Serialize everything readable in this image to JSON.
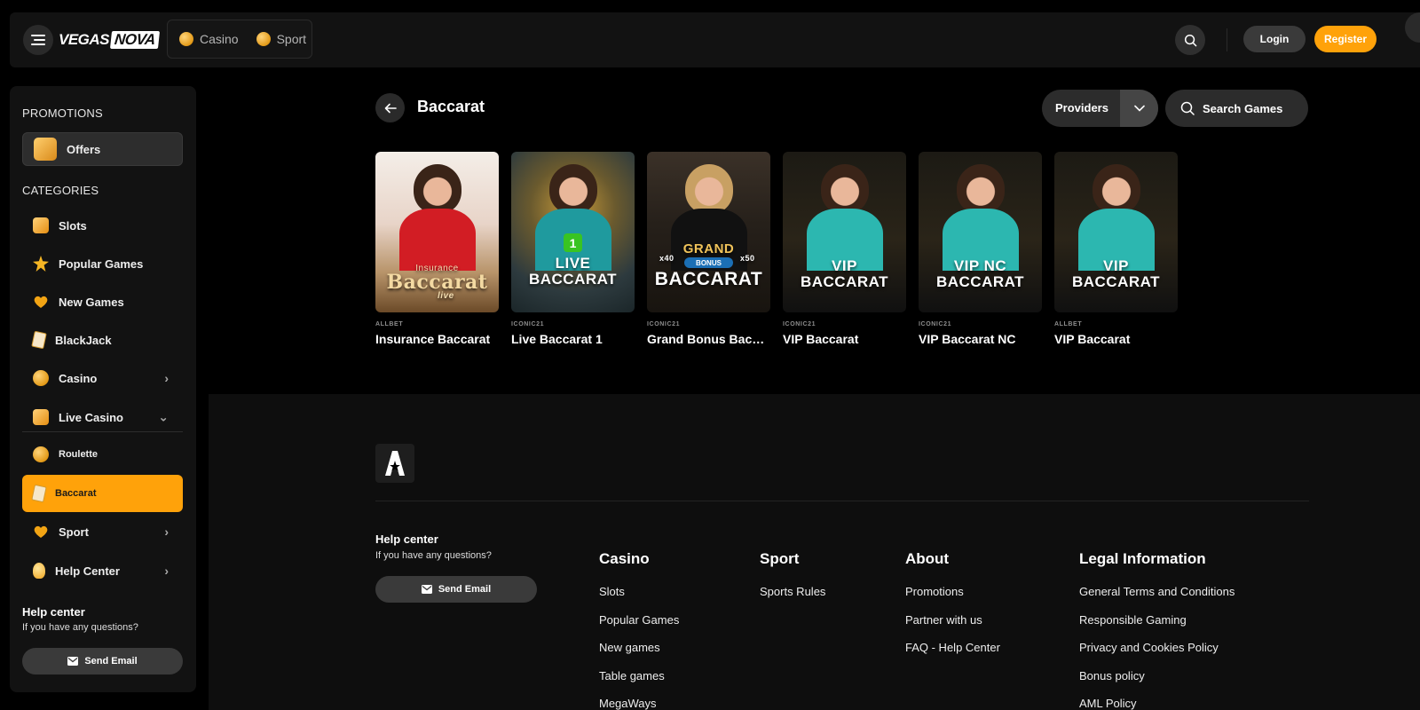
{
  "brand": {
    "logo_main": "VEGAS",
    "logo_accent": "NOVA"
  },
  "topnav": [
    {
      "label": "Casino",
      "icon": "casino-coin-icon"
    },
    {
      "label": "Sport",
      "icon": "sport-coin-icon"
    }
  ],
  "header": {
    "login_label": "Login",
    "register_label": "Register",
    "accent": "#ffa20a"
  },
  "sidebar": {
    "promotions_heading": "PROMOTIONS",
    "offers_label": "Offers",
    "categories_heading": "CATEGORIES",
    "items": [
      {
        "label": "Slots"
      },
      {
        "label": "Popular Games"
      },
      {
        "label": "New Games"
      },
      {
        "label": "BlackJack"
      },
      {
        "label": "Casino"
      },
      {
        "label": "Live Casino"
      },
      {
        "label": "Roulette"
      },
      {
        "label": "Baccarat"
      },
      {
        "label": "Sport"
      },
      {
        "label": "Help Center"
      }
    ],
    "help_title": "Help center",
    "help_sub": "If you have any questions?",
    "send_email": "Send Email"
  },
  "main": {
    "title": "Baccarat",
    "providers_label": "Providers",
    "search_label": "Search Games"
  },
  "games": [
    {
      "provider": "ALLBET",
      "name": "Insurance Baccarat",
      "thumb_text_top": "Insurance",
      "thumb_text": "Baccarat",
      "thumb_text_sub": "live"
    },
    {
      "provider": "ICONIC21",
      "name": "Live Baccarat 1",
      "thumb_badge": "1",
      "thumb_text": "LIVE\nBACCARAT"
    },
    {
      "provider": "ICONIC21",
      "name": "Grand Bonus Baccarat",
      "thumb_text_top": "GRAND",
      "thumb_badge": "BONUS",
      "thumb_mult_left": "x40",
      "thumb_mult_right": "x50",
      "thumb_text": "BACCARAT"
    },
    {
      "provider": "ICONIC21",
      "name": "VIP Baccarat",
      "thumb_text": "VIP\nBACCARAT"
    },
    {
      "provider": "ICONIC21",
      "name": "VIP Baccarat NC",
      "thumb_text": "VIP NC\nBACCARAT"
    },
    {
      "provider": "ALLBET",
      "name": "VIP Baccarat",
      "thumb_text": "VIP\nBACCARAT"
    }
  ],
  "footer": {
    "help_title": "Help center",
    "help_sub": "If you have any questions?",
    "send_email": "Send Email",
    "columns": [
      {
        "heading": "Casino",
        "links": [
          "Slots",
          "Popular Games",
          "New games",
          "Table games",
          "MegaWays"
        ]
      },
      {
        "heading": "Sport",
        "links": [
          "Sports Rules"
        ]
      },
      {
        "heading": "About",
        "links": [
          "Promotions",
          "Partner with us",
          "FAQ - Help Center"
        ]
      },
      {
        "heading": "Legal Information",
        "links": [
          "General Terms and Conditions",
          "Responsible Gaming",
          "Privacy and Cookies Policy",
          "Bonus policy",
          "AML Policy"
        ]
      }
    ]
  }
}
